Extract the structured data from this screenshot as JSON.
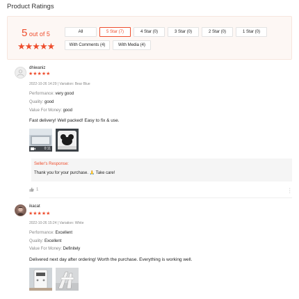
{
  "page": {
    "title": "Product Ratings"
  },
  "summary": {
    "score": "5",
    "out_of": " out of 5",
    "stars": "★★★★★",
    "filters": [
      {
        "label": "All"
      },
      {
        "label": "5 Star (7)"
      },
      {
        "label": "4 Star (0)"
      },
      {
        "label": "3 Star (0)"
      },
      {
        "label": "2 Star (0)"
      },
      {
        "label": "1 Star (0)"
      },
      {
        "label": "With Comments (4)"
      },
      {
        "label": "With Media (4)"
      }
    ],
    "active_filter": "5 Star (7)"
  },
  "reviews": [
    {
      "user": "dhiwaniz",
      "stars": "★★★★★",
      "meta": "2022-10-26 14:29 | Variation: Bear Blue",
      "attributes": [
        {
          "key": "Performance:",
          "value": " very good"
        },
        {
          "key": "Quality:",
          "value": " good"
        },
        {
          "key": "Value For Money:",
          "value": " good"
        }
      ],
      "comment": "Fast delivery! Well packed! Easy to fix & use.",
      "media": [
        {
          "type": "video",
          "duration": "0:11"
        },
        {
          "type": "image"
        }
      ],
      "response": {
        "title": "Seller's Response:",
        "text": "Thank you for your purchase. 🙏 Take care!"
      },
      "likes": "1"
    },
    {
      "user": "ikacat",
      "stars": "★★★★★",
      "meta": "2022-10-26 15:24 | Variation: White",
      "attributes": [
        {
          "key": "Performance:",
          "value": " Excellent"
        },
        {
          "key": "Quality:",
          "value": " Excellent"
        },
        {
          "key": "Value For Money:",
          "value": " Definitely"
        }
      ],
      "comment": "Delivered next day after ordering! Worth the purchase. Everything is working well.",
      "media": [
        {
          "type": "image"
        },
        {
          "type": "image"
        }
      ]
    }
  ],
  "colors": {
    "accent": "#ee4d2d",
    "summary_bg": "#fdf7f4",
    "response_bg": "#f5f5f5"
  }
}
